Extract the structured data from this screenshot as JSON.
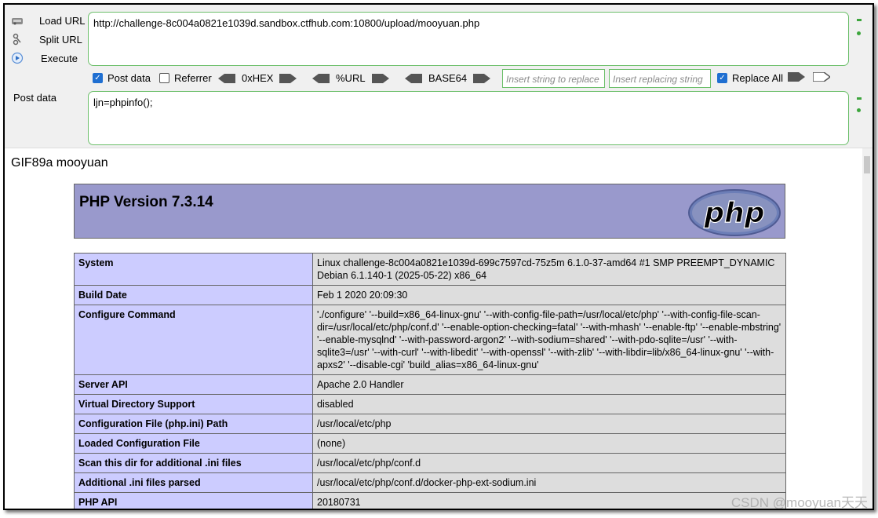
{
  "hackbar": {
    "menu": [
      {
        "label": "Load URL",
        "icon": "load-url-icon"
      },
      {
        "label": "Split URL",
        "icon": "split-url-icon"
      },
      {
        "label": "Execute",
        "icon": "execute-icon"
      }
    ],
    "url_value": "http://challenge-8c004a0821e1039d.sandbox.ctfhub.com:10800/upload/mooyuan.php",
    "options": {
      "post_data": {
        "label": "Post data",
        "checked": true
      },
      "referrer": {
        "label": "Referrer",
        "checked": false
      },
      "hex": "0xHEX",
      "url": "%URL",
      "base64": "BASE64",
      "insert_placeholder": "Insert string to replace",
      "replacing_placeholder": "Insert replacing string",
      "replace_all": {
        "label": "Replace All",
        "checked": true
      }
    },
    "post_label": "Post data",
    "post_value": "ljn=phpinfo();"
  },
  "page": {
    "gif_text": "GIF89a mooyuan",
    "php_version": "PHP Version 7.3.14",
    "logo_text": "php",
    "rows": [
      {
        "key": "System",
        "value": "Linux challenge-8c004a0821e1039d-699c7597cd-75z5m 6.1.0-37-amd64 #1 SMP PREEMPT_DYNAMIC Debian 6.1.140-1 (2025-05-22) x86_64"
      },
      {
        "key": "Build Date",
        "value": "Feb 1 2020 20:09:30"
      },
      {
        "key": "Configure Command",
        "value": "'./configure' '--build=x86_64-linux-gnu' '--with-config-file-path=/usr/local/etc/php' '--with-config-file-scan-dir=/usr/local/etc/php/conf.d' '--enable-option-checking=fatal' '--with-mhash' '--enable-ftp' '--enable-mbstring' '--enable-mysqlnd' '--with-password-argon2' '--with-sodium=shared' '--with-pdo-sqlite=/usr' '--with-sqlite3=/usr' '--with-curl' '--with-libedit' '--with-openssl' '--with-zlib' '--with-libdir=lib/x86_64-linux-gnu' '--with-apxs2' '--disable-cgi' 'build_alias=x86_64-linux-gnu'"
      },
      {
        "key": "Server API",
        "value": "Apache 2.0 Handler"
      },
      {
        "key": "Virtual Directory Support",
        "value": "disabled"
      },
      {
        "key": "Configuration File (php.ini) Path",
        "value": "/usr/local/etc/php"
      },
      {
        "key": "Loaded Configuration File",
        "value": "(none)"
      },
      {
        "key": "Scan this dir for additional .ini files",
        "value": "/usr/local/etc/php/conf.d"
      },
      {
        "key": "Additional .ini files parsed",
        "value": "/usr/local/etc/php/conf.d/docker-php-ext-sodium.ini"
      },
      {
        "key": "PHP API",
        "value": "20180731"
      }
    ]
  },
  "watermark": "CSDN @mooyuan天天",
  "colors": {
    "accent_green": "#6cbf6a",
    "php_header": "#9999cc",
    "php_key": "#ccccff",
    "php_value": "#dddddd",
    "checkbox": "#1f6fd1"
  }
}
